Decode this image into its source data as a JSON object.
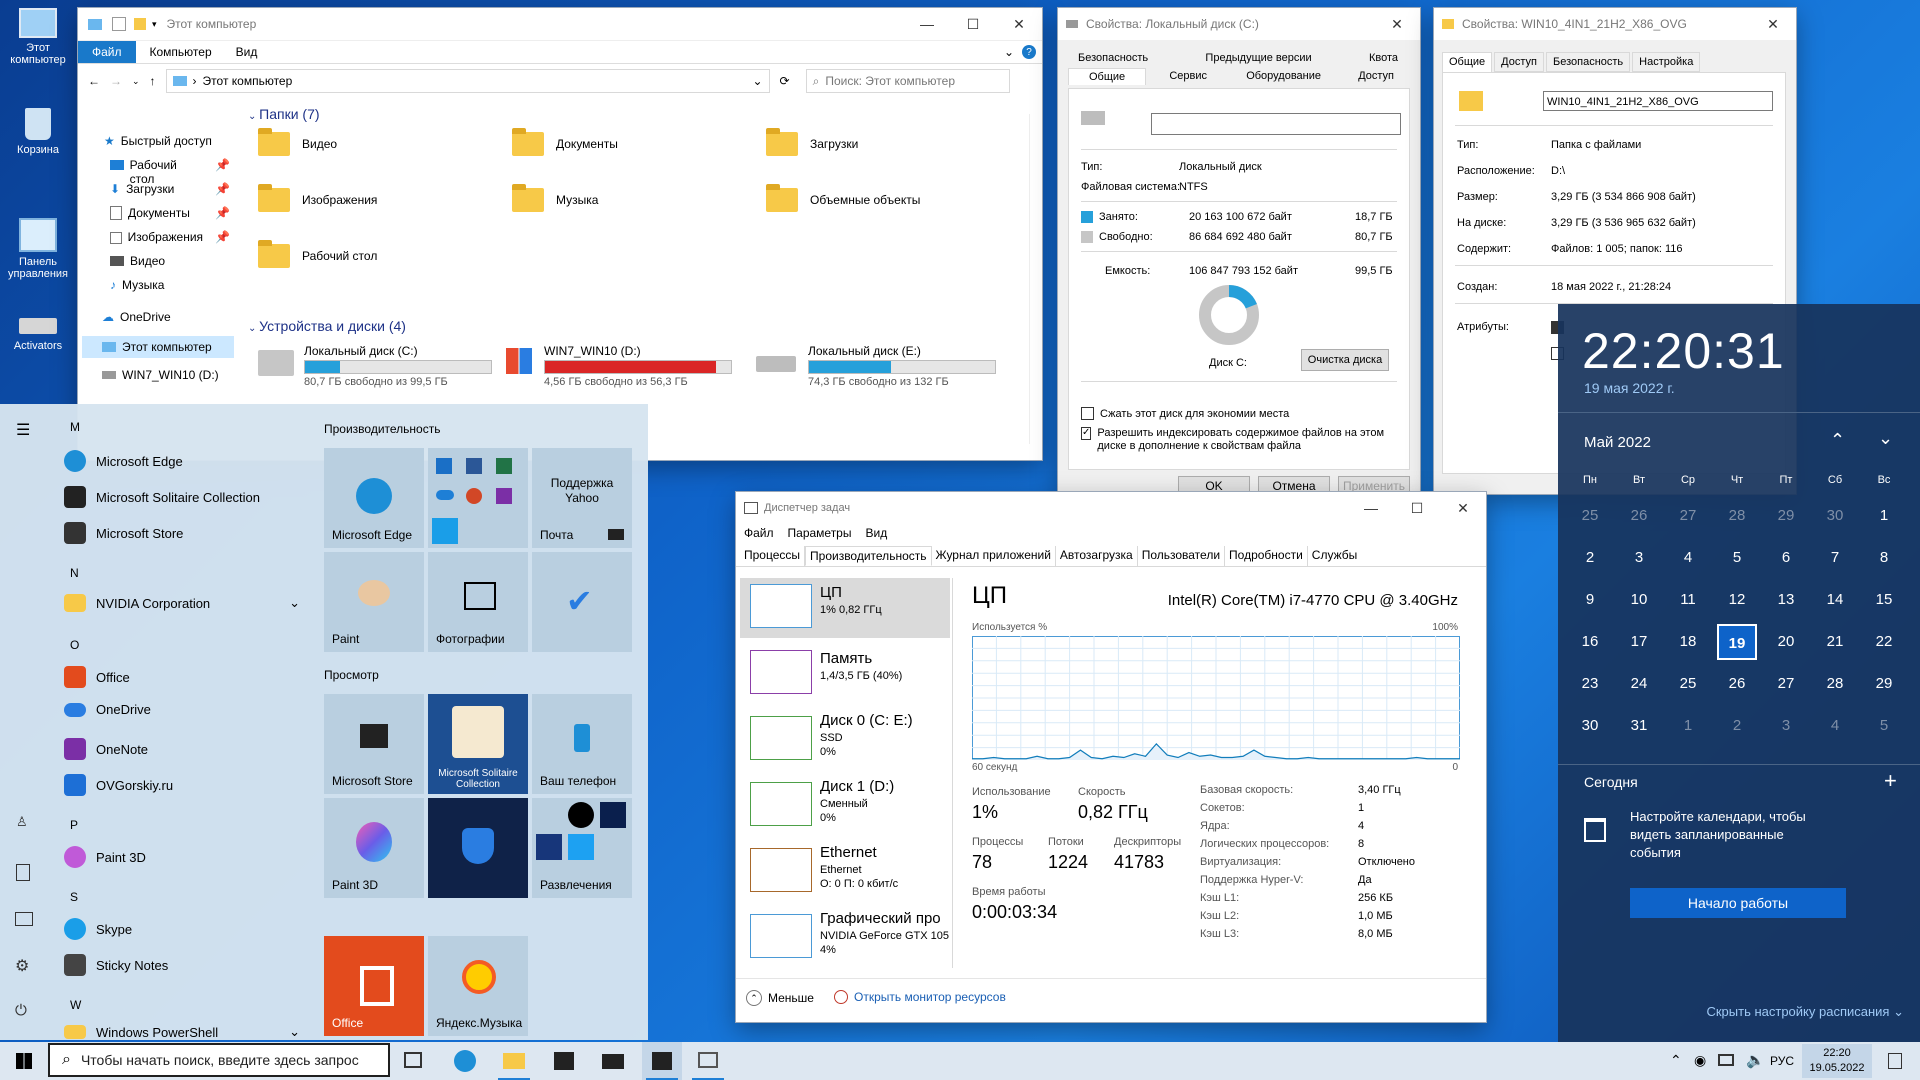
{
  "desktop": {
    "icons": [
      {
        "label": "Этот компьютер"
      },
      {
        "label": "Корзина"
      },
      {
        "label": "Панель управления"
      },
      {
        "label": "Activators"
      }
    ]
  },
  "explorer": {
    "title": "Этот компьютер",
    "ribbon_tabs": [
      "Файл",
      "Компьютер",
      "Вид"
    ],
    "address": "Этот компьютер",
    "search_placeholder": "Поиск: Этот компьютер",
    "nav": [
      {
        "label": "Быстрый доступ"
      },
      {
        "label": "Рабочий стол"
      },
      {
        "label": "Загрузки"
      },
      {
        "label": "Документы"
      },
      {
        "label": "Изображения"
      },
      {
        "label": "Видео"
      },
      {
        "label": "Музыка"
      },
      {
        "label": "OneDrive"
      },
      {
        "label": "Этот компьютер"
      },
      {
        "label": "WIN7_WIN10 (D:)"
      }
    ],
    "folders_header": "Папки (7)",
    "folders": [
      "Видео",
      "Документы",
      "Загрузки",
      "Изображения",
      "Музыка",
      "Объемные объекты",
      "Рабочий стол"
    ],
    "drives_header": "Устройства и диски (4)",
    "drives": [
      {
        "name": "Локальный диск (C:)",
        "free": "80,7 ГБ свободно из 99,5 ГБ",
        "used_pct": 19,
        "color": "#26a0da"
      },
      {
        "name": "WIN7_WIN10 (D:)",
        "free": "4,56 ГБ свободно из 56,3 ГБ",
        "used_pct": 92,
        "color": "#da2626"
      },
      {
        "name": "Локальный диск (E:)",
        "free": "74,3 ГБ свободно из 132 ГБ",
        "used_pct": 44,
        "color": "#26a0da"
      }
    ]
  },
  "propc": {
    "title": "Свойства: Локальный диск (C:)",
    "tabs_row1": [
      "Безопасность",
      "Предыдущие версии",
      "Квота"
    ],
    "tabs_row2": [
      "Общие",
      "Сервис",
      "Оборудование",
      "Доступ"
    ],
    "type_label": "Тип:",
    "type_value": "Локальный диск",
    "fs_label": "Файловая система:",
    "fs_value": "NTFS",
    "used_label": "Занято:",
    "used_bytes": "20 163 100 672 байт",
    "used_gb": "18,7 ГБ",
    "free_label": "Свободно:",
    "free_bytes": "86 684 692 480 байт",
    "free_gb": "80,7 ГБ",
    "cap_label": "Емкость:",
    "cap_bytes": "106 847 793 152 байт",
    "cap_gb": "99,5 ГБ",
    "disk_label": "Диск C:",
    "cleanup": "Очистка диска",
    "compress": "Сжать этот диск для экономии места",
    "index": "Разрешить индексировать содержимое файлов на этом диске в дополнение к свойствам файла",
    "ok": "OK",
    "cancel": "Отмена",
    "apply": "Применить",
    "used_fraction": 0.19
  },
  "propf": {
    "title": "Свойства: WIN10_4IN1_21H2_X86_OVG",
    "tabs": [
      "Общие",
      "Доступ",
      "Безопасность",
      "Настройка"
    ],
    "name": "WIN10_4IN1_21H2_X86_OVG",
    "rows": [
      {
        "k": "Тип:",
        "v": "Папка с файлами"
      },
      {
        "k": "Расположение:",
        "v": "D:\\"
      },
      {
        "k": "Размер:",
        "v": "3,29 ГБ (3 534 866 908 байт)"
      },
      {
        "k": "На диске:",
        "v": "3,29 ГБ (3 536 965 632 байт)"
      },
      {
        "k": "Содержит:",
        "v": "Файлов: 1 005; папок: 116"
      },
      {
        "k": "Создан:",
        "v": "18 мая 2022 г., 21:28:24"
      },
      {
        "k": "Атрибуты:",
        "v": ""
      }
    ]
  },
  "clock": {
    "time": "22:20:31",
    "date": "19 мая 2022 г.",
    "month": "Май 2022",
    "weekdays": [
      "Пн",
      "Вт",
      "Ср",
      "Чт",
      "Пт",
      "Сб",
      "Вс"
    ],
    "weeks": [
      [
        {
          "d": "25",
          "dim": true
        },
        {
          "d": "26",
          "dim": true
        },
        {
          "d": "27",
          "dim": true
        },
        {
          "d": "28",
          "dim": true
        },
        {
          "d": "29",
          "dim": true
        },
        {
          "d": "30",
          "dim": true
        },
        {
          "d": "1"
        }
      ],
      [
        {
          "d": "2"
        },
        {
          "d": "3"
        },
        {
          "d": "4"
        },
        {
          "d": "5"
        },
        {
          "d": "6"
        },
        {
          "d": "7"
        },
        {
          "d": "8"
        }
      ],
      [
        {
          "d": "9"
        },
        {
          "d": "10"
        },
        {
          "d": "11"
        },
        {
          "d": "12"
        },
        {
          "d": "13"
        },
        {
          "d": "14"
        },
        {
          "d": "15"
        }
      ],
      [
        {
          "d": "16"
        },
        {
          "d": "17"
        },
        {
          "d": "18"
        },
        {
          "d": "19",
          "today": true
        },
        {
          "d": "20"
        },
        {
          "d": "21"
        },
        {
          "d": "22"
        }
      ],
      [
        {
          "d": "23"
        },
        {
          "d": "24"
        },
        {
          "d": "25"
        },
        {
          "d": "26"
        },
        {
          "d": "27"
        },
        {
          "d": "28"
        },
        {
          "d": "29"
        }
      ],
      [
        {
          "d": "30"
        },
        {
          "d": "31"
        },
        {
          "d": "1",
          "dim": true
        },
        {
          "d": "2",
          "dim": true
        },
        {
          "d": "3",
          "dim": true
        },
        {
          "d": "4",
          "dim": true
        },
        {
          "d": "5",
          "dim": true
        }
      ]
    ],
    "today_label": "Сегодня",
    "agenda_text": "Настройте календари, чтобы видеть запланированные события",
    "start_button": "Начало работы",
    "hide_schedule": "Скрыть настройку расписания"
  },
  "start": {
    "letters": {
      "m": "M",
      "n": "N",
      "o": "O",
      "p": "P",
      "s": "S",
      "w": "W"
    },
    "apps": [
      {
        "label": "Microsoft Edge",
        "color": "#1e8fd6"
      },
      {
        "label": "Microsoft Solitaire Collection",
        "color": "#222"
      },
      {
        "label": "Microsoft Store",
        "color": "#333"
      },
      {
        "label": "NVIDIA Corporation",
        "color": "#f7c948"
      },
      {
        "label": "Office",
        "color": "#e34b1d"
      },
      {
        "label": "OneDrive",
        "color": "#2a7de1"
      },
      {
        "label": "OneNote",
        "color": "#7b2fa6"
      },
      {
        "label": "OVGorskiy.ru",
        "color": "#1d6fd6"
      },
      {
        "label": "Paint 3D",
        "color": "#c05ad8"
      },
      {
        "label": "Skype",
        "color": "#1a9ee8"
      },
      {
        "label": "Sticky Notes",
        "color": "#444"
      },
      {
        "label": "Windows PowerShell",
        "color": "#f7c948"
      }
    ],
    "group1": "Производительность",
    "group2": "Просмотр",
    "tiles": {
      "edge": "Microsoft Edge",
      "yahoo": "Поддержка Yahoo",
      "mail": "Почта",
      "paint": "Paint",
      "photos": "Фотографии",
      "store": "Microsoft Store",
      "solitaire": "Microsoft Solitaire Collection",
      "phone": "Ваш телефон",
      "paint3d": "Paint 3D",
      "fun": "Развлечения",
      "office": "Office",
      "ymusic": "Яндекс.Музыка"
    }
  },
  "taskmgr": {
    "title": "Диспетчер задач",
    "menu": [
      "Файл",
      "Параметры",
      "Вид"
    ],
    "tabs": [
      "Процессы",
      "Производительность",
      "Журнал приложений",
      "Автозагрузка",
      "Пользователи",
      "Подробности",
      "Службы"
    ],
    "side": [
      {
        "name": "ЦП",
        "l1": "1% 0,82 ГГц",
        "l2": ""
      },
      {
        "name": "Память",
        "l1": "1,4/3,5 ГБ (40%)",
        "l2": ""
      },
      {
        "name": "Диск 0 (C: E:)",
        "l1": "SSD",
        "l2": "0%"
      },
      {
        "name": "Диск 1 (D:)",
        "l1": "Сменный",
        "l2": "0%"
      },
      {
        "name": "Ethernet",
        "l1": "Ethernet",
        "l2": "О: 0 П: 0 кбит/с"
      },
      {
        "name": "Графический про",
        "l1": "NVIDIA GeForce GTX 105",
        "l2": "4%"
      }
    ],
    "cpu_title": "ЦП",
    "cpu_model": "Intel(R) Core(TM) i7-4770 CPU @ 3.40GHz",
    "usage_label": "Используется %",
    "max_label": "100%",
    "time_label": "60 секунд",
    "zero_label": "0",
    "stats": {
      "usage_k": "Использование",
      "usage_v": "1%",
      "speed_k": "Скорость",
      "speed_v": "0,82 ГГц",
      "proc_k": "Процессы",
      "proc_v": "78",
      "threads_k": "Потоки",
      "threads_v": "1224",
      "handles_k": "Дескрипторы",
      "handles_v": "41783",
      "uptime_k": "Время работы",
      "uptime_v": "0:00:03:34"
    },
    "details": [
      {
        "k": "Базовая скорость:",
        "v": "3,40 ГГц"
      },
      {
        "k": "Сокетов:",
        "v": "1"
      },
      {
        "k": "Ядра:",
        "v": "4"
      },
      {
        "k": "Логических процессоров:",
        "v": "8"
      },
      {
        "k": "Виртуализация:",
        "v": "Отключено"
      },
      {
        "k": "Поддержка Hyper-V:",
        "v": "Да"
      },
      {
        "k": "Кэш L1:",
        "v": "256 КБ"
      },
      {
        "k": "Кэш L2:",
        "v": "1,0 МБ"
      },
      {
        "k": "Кэш L3:",
        "v": "8,0 МБ"
      }
    ],
    "less": "Меньше",
    "resmon": "Открыть монитор ресурсов",
    "cpu_series": [
      1,
      1,
      2,
      1,
      1,
      1,
      3,
      1,
      1,
      2,
      8,
      2,
      1,
      3,
      2,
      5,
      3,
      13,
      4,
      2,
      6,
      3,
      4,
      2,
      2,
      3,
      8,
      3,
      2,
      1,
      1,
      2,
      1,
      1,
      1,
      1,
      1,
      1,
      1,
      1,
      1,
      2,
      1,
      1,
      1,
      1
    ]
  },
  "taskbar": {
    "search_placeholder": "Чтобы начать поиск, введите здесь запрос",
    "lang": "РУС",
    "time": "22:20",
    "date": "19.05.2022"
  }
}
